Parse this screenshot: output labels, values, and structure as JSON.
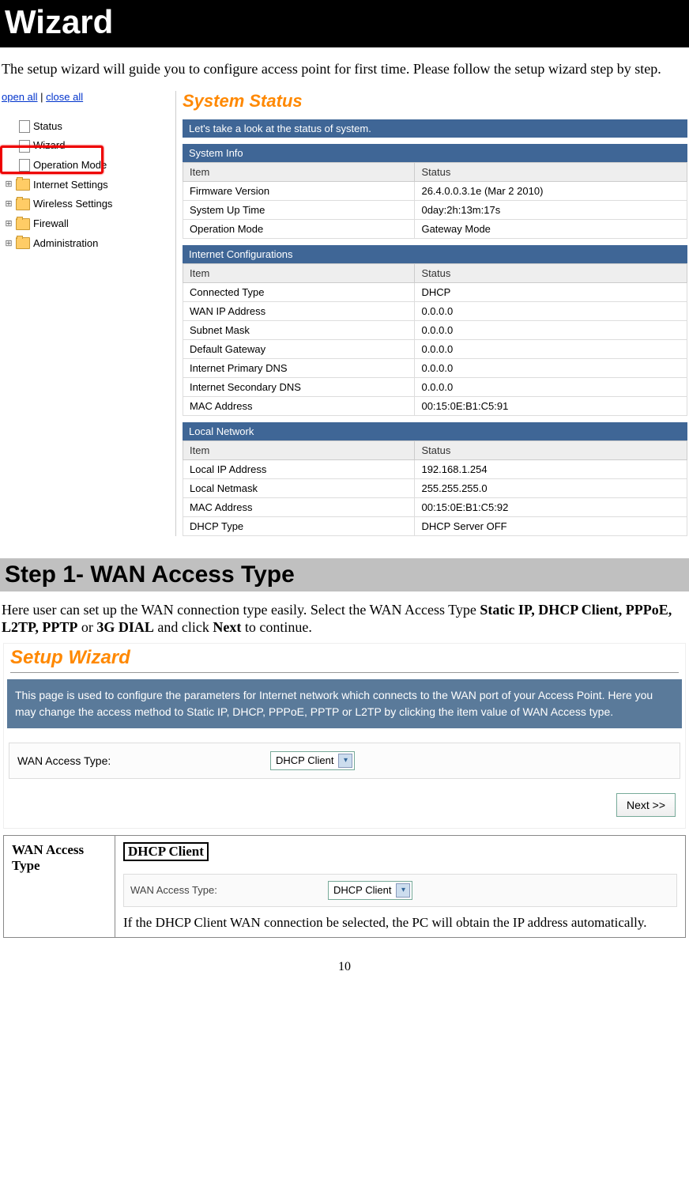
{
  "header": "Wizard",
  "intro": "The setup wizard will guide you to configure access point for first time. Please follow the setup wizard step by step.",
  "links": {
    "open": "open all",
    "sep": " | ",
    "close": "close all"
  },
  "tree": {
    "status": "Status",
    "wizard": "Wizard",
    "opmode": "Operation Mode",
    "internet": "Internet Settings",
    "wireless": "Wireless Settings",
    "firewall": "Firewall",
    "admin": "Administration"
  },
  "systemStatus": {
    "title": "System Status",
    "sub": "Let's take a look at the status of system.",
    "sections": [
      {
        "name": "System Info",
        "header": [
          "Item",
          "Status"
        ],
        "rows": [
          [
            "Firmware Version",
            "26.4.0.0.3.1e (Mar 2 2010)"
          ],
          [
            "System Up Time",
            "0day:2h:13m:17s"
          ],
          [
            "Operation Mode",
            "Gateway Mode"
          ]
        ]
      },
      {
        "name": "Internet Configurations",
        "header": [
          "Item",
          "Status"
        ],
        "rows": [
          [
            "Connected Type",
            "DHCP"
          ],
          [
            "WAN IP Address",
            "0.0.0.0"
          ],
          [
            "Subnet Mask",
            "0.0.0.0"
          ],
          [
            "Default Gateway",
            "0.0.0.0"
          ],
          [
            "Internet Primary DNS",
            "0.0.0.0"
          ],
          [
            "Internet Secondary DNS",
            "0.0.0.0"
          ],
          [
            "MAC Address",
            "00:15:0E:B1:C5:91"
          ]
        ]
      },
      {
        "name": "Local Network",
        "header": [
          "Item",
          "Status"
        ],
        "rows": [
          [
            "Local IP Address",
            "192.168.1.254"
          ],
          [
            "Local Netmask",
            "255.255.255.0"
          ],
          [
            "MAC Address",
            "00:15:0E:B1:C5:92"
          ],
          [
            "DHCP Type",
            "DHCP Server OFF"
          ]
        ]
      }
    ]
  },
  "step1": {
    "heading": "Step 1- WAN Access Type",
    "intro_pre": "Here user can set up the WAN connection type easily. Select the WAN Access Type ",
    "bold1": "Static IP, DHCP Client, PPPoE, L2TP, PPTP",
    "intro_mid": " or ",
    "bold2": "3G DIAL",
    "intro_mid2": " and click ",
    "bold3": "Next",
    "intro_post": " to continue."
  },
  "wizard": {
    "title": "Setup Wizard",
    "banner": "This page is used to configure the parameters for Internet network which connects to the WAN port of your Access Point. Here you may change the access method to Static IP, DHCP, PPPoE, PPTP or L2TP by clicking the item value of WAN Access type.",
    "label": "WAN Access Type:",
    "value": "DHCP Client",
    "next": "Next >>"
  },
  "defTable": {
    "left": "WAN Access Type",
    "boxed": "DHCP Client",
    "formLabel": "WAN Access Type:",
    "formValue": "DHCP Client",
    "desc": "If the DHCP Client WAN connection be selected, the PC will obtain the IP address automatically."
  },
  "pagenum": "10"
}
